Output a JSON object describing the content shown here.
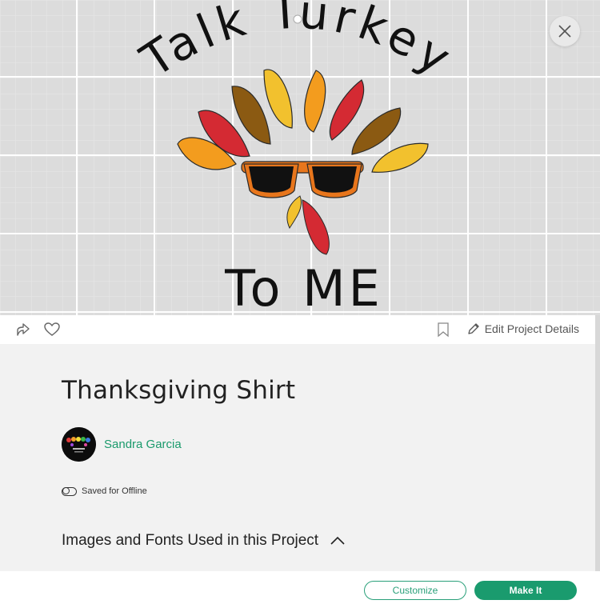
{
  "canvas": {
    "artwork_text_top": "Talk Turkey",
    "artwork_text_bottom": "To ME"
  },
  "toolbar": {
    "share_icon": "share-arrow-icon",
    "like_icon": "heart-icon",
    "bookmark_icon": "bookmark-icon",
    "edit_label": "Edit Project Details"
  },
  "project": {
    "title": "Thanksgiving Shirt",
    "author": "Sandra Garcia",
    "offline_label": "Saved for Offline",
    "section_label": "Images and Fonts Used in this Project"
  },
  "footer": {
    "customize_label": "Customize",
    "make_label": "Make It"
  },
  "colors": {
    "accent": "#1a9b6e",
    "link": "#1b9a6c"
  }
}
